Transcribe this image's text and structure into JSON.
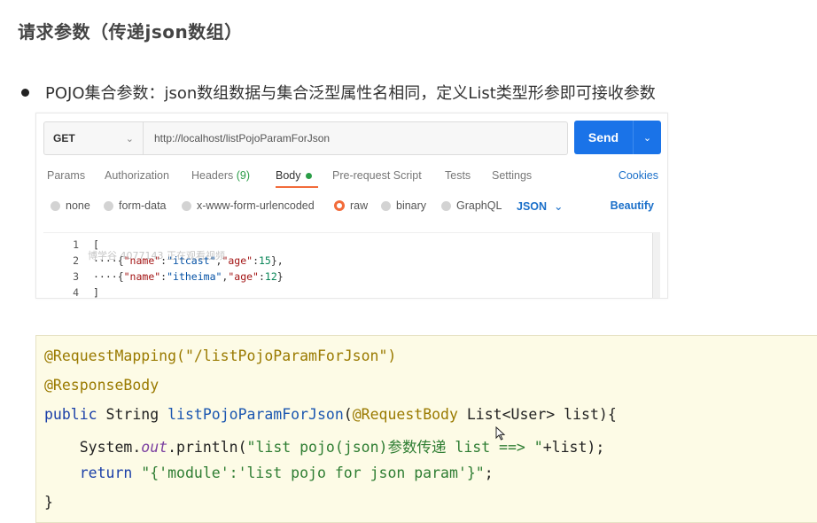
{
  "slide": {
    "title": "请求参数（传递json数组）",
    "bullet": "POJO集合参数：json数组数据与集合泛型属性名相同，定义List类型形参即可接收参数"
  },
  "postman": {
    "method": "GET",
    "url": "http://localhost/listPojoParamForJson",
    "send_label": "Send",
    "tabs": [
      {
        "label": "Params"
      },
      {
        "label": "Authorization"
      },
      {
        "label": "Headers",
        "count": "(9)"
      },
      {
        "label": "Body",
        "active": true
      },
      {
        "label": "Pre-request Script"
      },
      {
        "label": "Tests"
      },
      {
        "label": "Settings"
      }
    ],
    "cookies_label": "Cookies",
    "body_options": [
      {
        "label": "none"
      },
      {
        "label": "form-data"
      },
      {
        "label": "x-www-form-urlencoded"
      },
      {
        "label": "raw",
        "selected": true
      },
      {
        "label": "binary"
      },
      {
        "label": "GraphQL"
      }
    ],
    "format": "JSON",
    "beautify_label": "Beautify",
    "editor": {
      "line_numbers": [
        "1",
        "2",
        "3",
        "4"
      ],
      "watermark": "博学谷 4077143 正在观看视频"
    }
  },
  "code": {
    "line1": "@RequestMapping(\"/listPojoParamForJson\")",
    "line2": "@ResponseBody",
    "line3_kw": "public",
    "line3_type": "String",
    "line3_fn": "listPojoParamForJson",
    "line3_ann": "@RequestBody",
    "line3_rest": "List<User> list){",
    "line4_sys": "System.",
    "line4_out": "out",
    "line4_call": ".println(",
    "line4_str": "\"list pojo(json)参数传递 list ==> \"",
    "line4_tail": "+list);",
    "line5_kw": "return",
    "line5_str": "\"{'module':'list pojo for json param'}\"",
    "line5_tail": ";",
    "line6": "}"
  }
}
